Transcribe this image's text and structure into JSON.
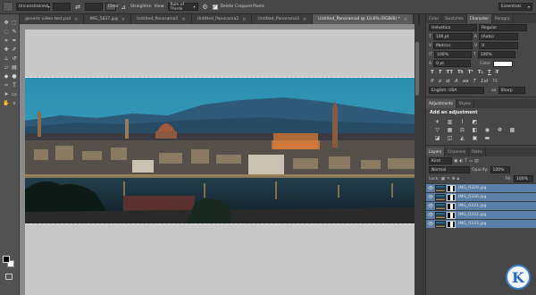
{
  "options_bar": {
    "style_value": "Unconstrained",
    "clear_label": "Clear",
    "straighten_label": "Straighten",
    "view_label": "View:",
    "view_value": "Rule of Thirds",
    "delete_cropped_label": "Delete Cropped Pixels",
    "delete_cropped_checked": true,
    "workspace_value": "Essentials"
  },
  "tabs": [
    {
      "label": "generic video test.psd",
      "active": false
    },
    {
      "label": "IMG_5837.jpg",
      "active": false
    },
    {
      "label": "Untitled_Panorama1",
      "active": false
    },
    {
      "label": "Untitled_Panorama2",
      "active": false
    },
    {
      "label": "Untitled_Panorama3",
      "active": false
    },
    {
      "label": "Untitled_Panorama4 @ 10.6% (RGB/8) *",
      "active": true
    }
  ],
  "character_panel": {
    "tabs": [
      "Color",
      "Swatches",
      "Character",
      "Paragra"
    ],
    "active_tab": "Character",
    "font_family": "Helvetica",
    "font_style": "Regular",
    "font_size": "100 pt",
    "leading": "(Auto)",
    "kerning": "Metrics",
    "tracking": "0",
    "vertical_scale": "100%",
    "horizontal_scale": "100%",
    "baseline_shift": "0 pt",
    "color_label": "Color:",
    "style_glyphs": [
      "T",
      "T",
      "TT",
      "Tt",
      "T¹",
      "T₁",
      "T",
      "T̶"
    ],
    "opentype_glyphs": [
      "fi",
      "ơ",
      "st",
      "A",
      "aa",
      "T",
      "1st",
      "½"
    ],
    "language": "English: USA",
    "anti_alias": "Sharp"
  },
  "adjustments_panel": {
    "tabs": [
      "Adjustments",
      "Styles"
    ],
    "active_tab": "Adjustments",
    "title": "Add an adjustment",
    "row1_icons": [
      "brightness-icon",
      "levels-icon",
      "curves-icon",
      "exposure-icon"
    ],
    "row2_icons": [
      "vibrance-icon",
      "hue-saturation-icon",
      "color-balance-icon",
      "black-white-icon",
      "photo-filter-icon",
      "channel-mixer-icon",
      "color-lookup-icon"
    ],
    "row3_icons": [
      "invert-icon",
      "posterize-icon",
      "threshold-icon",
      "selective-color-icon",
      "gradient-map-icon"
    ]
  },
  "layers_panel": {
    "tabs": [
      "Layers",
      "Channels",
      "Paths"
    ],
    "active_tab": "Layers",
    "filter_value": "Kind",
    "blend_mode": "Normal",
    "opacity_label": "Opacity:",
    "opacity": "100%",
    "lock_label": "Lock:",
    "fill_label": "Fill:",
    "fill": "100%",
    "layers": [
      {
        "name": "IMG_0329.jpg",
        "visible": true
      },
      {
        "name": "IMG_0330.jpg",
        "visible": true
      },
      {
        "name": "IMG_0331.jpg",
        "visible": true
      },
      {
        "name": "IMG_0332.jpg",
        "visible": true
      },
      {
        "name": "IMG_0333.jpg",
        "visible": true
      }
    ]
  },
  "colors": {
    "ui_dark": "#2b2b2b",
    "panel": "#474747",
    "toolbar": "#535353",
    "selection": "#5b7fa8",
    "canvas_bg": "#c8c8c8"
  },
  "logo": {
    "letter": "K"
  }
}
